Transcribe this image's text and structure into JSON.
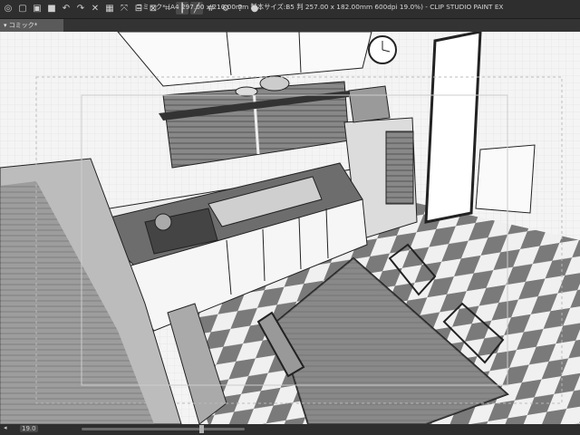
{
  "app": {
    "window_title": "コミック* (A4 297.00 x 210.00mm 製本サイズ:B5 判 257.00 x 182.00mm 600dpi 19.0%) - CLIP STUDIO PAINT EX",
    "tab_label": "コミック*",
    "zoom_label": "19.0"
  },
  "toolbar": {
    "icons": [
      "app-menu-icon",
      "new-file-icon",
      "open-file-icon",
      "save-icon",
      "undo-icon",
      "redo-icon",
      "clear-icon",
      "fill-icon",
      "transform-icon",
      "deselect-icon",
      "invert-selection-icon",
      "crop-icon",
      "snap-to-ruler-icon",
      "snap-to-special-ruler-icon",
      "snap-to-grid-icon",
      "settings-icon",
      "help-icon",
      "account-icon"
    ]
  }
}
